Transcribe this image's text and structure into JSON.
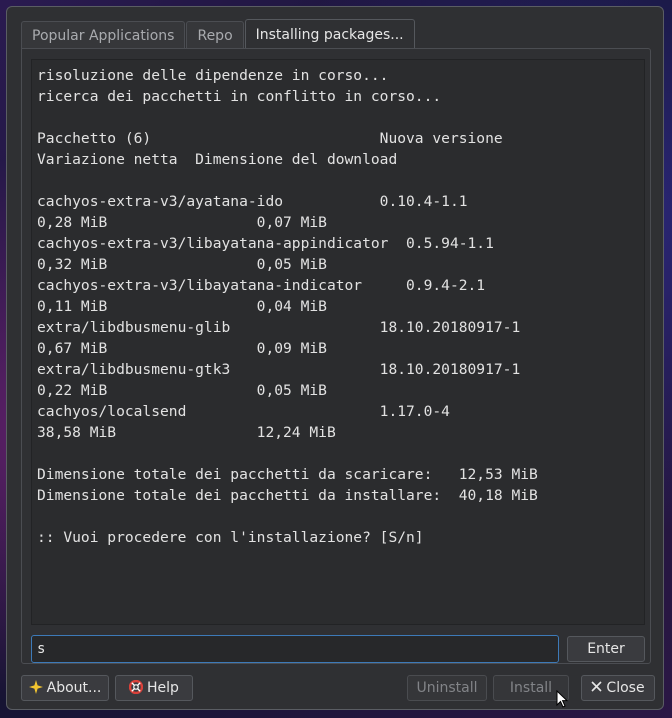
{
  "tabs": [
    {
      "label": "Popular Applications"
    },
    {
      "label": "Repo"
    },
    {
      "label": "Installing packages..."
    }
  ],
  "terminal": {
    "lines": [
      "risoluzione delle dipendenze in corso...",
      "ricerca dei pacchetti in conflitto in corso...",
      "",
      "Pacchetto (6)                          Nuova versione",
      "Variazione netta  Dimensione del download",
      "",
      "cachyos-extra-v3/ayatana-ido           0.10.4-1.1",
      "0,28 MiB                 0,07 MiB",
      "cachyos-extra-v3/libayatana-appindicator  0.5.94-1.1",
      "0,32 MiB                 0,05 MiB",
      "cachyos-extra-v3/libayatana-indicator     0.9.4-2.1",
      "0,11 MiB                 0,04 MiB",
      "extra/libdbusmenu-glib                 18.10.20180917-1",
      "0,67 MiB                 0,09 MiB",
      "extra/libdbusmenu-gtk3                 18.10.20180917-1",
      "0,22 MiB                 0,05 MiB",
      "cachyos/localsend                      1.17.0-4",
      "38,58 MiB                12,24 MiB",
      "",
      "Dimensione totale dei pacchetti da scaricare:   12,53 MiB",
      "Dimensione totale dei pacchetti da installare:  40,18 MiB",
      "",
      ":: Vuoi procedere con l'installazione? [S/n]"
    ]
  },
  "input": {
    "value": "s"
  },
  "buttons": {
    "enter": "Enter",
    "about": "About...",
    "help": "Help",
    "uninstall": "Uninstall",
    "install": "Install",
    "close": "Close"
  },
  "icons": {
    "about": "sparkle-icon",
    "help": "lifebuoy-icon",
    "close": "close-icon"
  },
  "colors": {
    "accent_border": "#3d7ab8",
    "about_icon": "#f2c530",
    "help_icon": "#d9413a"
  }
}
